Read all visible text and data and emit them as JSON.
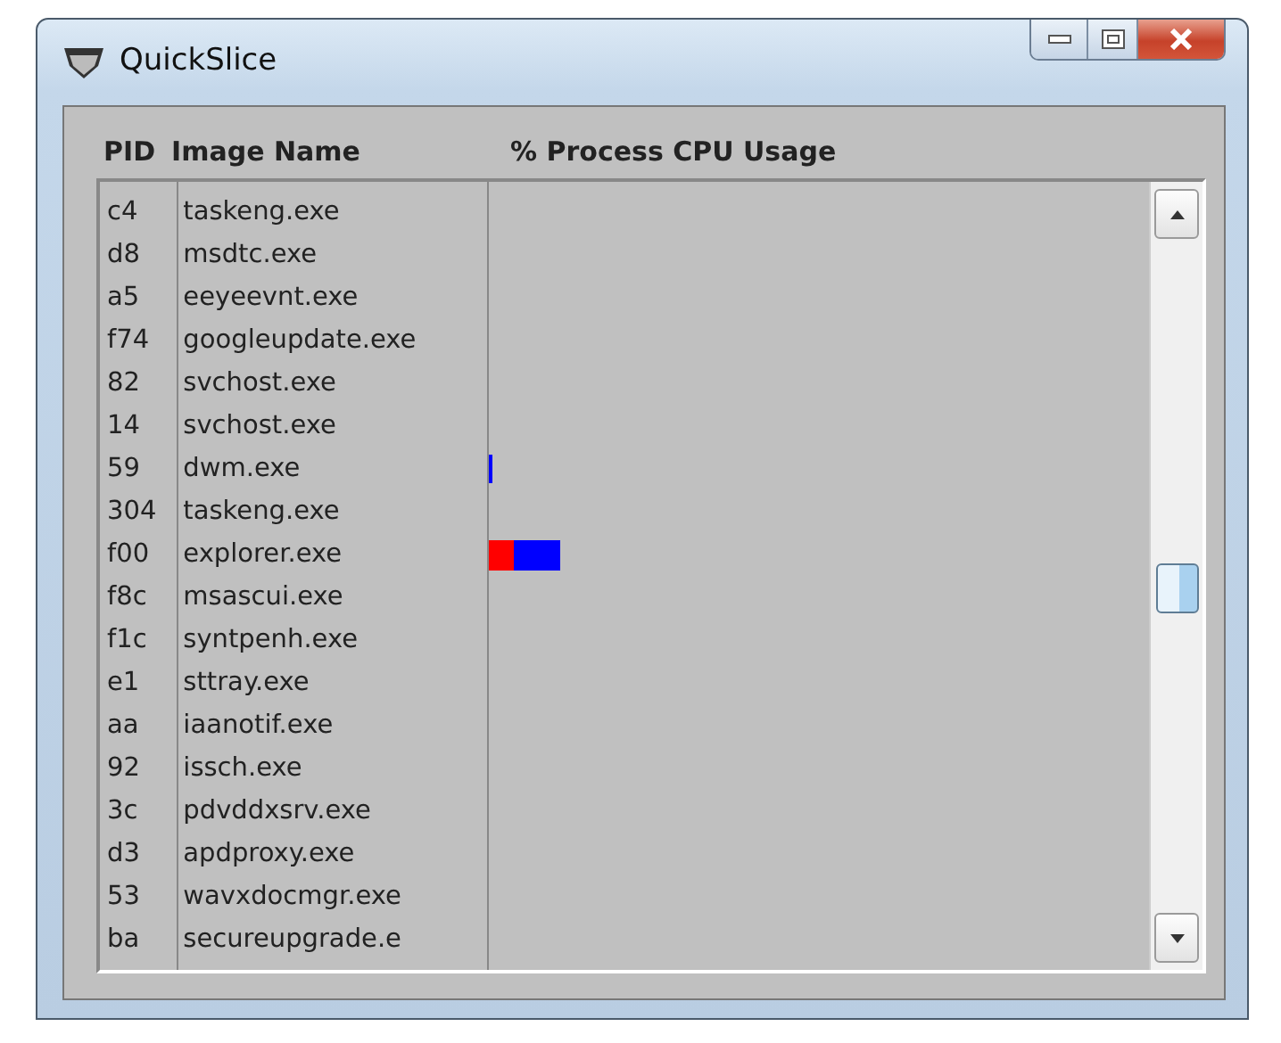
{
  "window": {
    "title": "QuickSlice"
  },
  "columns": [
    {
      "label": "PID"
    },
    {
      "label": "Image Name"
    },
    {
      "label": "% Process CPU Usage"
    }
  ],
  "rows": [
    {
      "pid": "c4",
      "image": "taskeng.exe"
    },
    {
      "pid": "d8",
      "image": "msdtc.exe"
    },
    {
      "pid": "a5",
      "image": "eeyeevnt.exe"
    },
    {
      "pid": "f74",
      "image": "googleupdate.exe"
    },
    {
      "pid": "82",
      "image": "svchost.exe"
    },
    {
      "pid": "14",
      "image": "svchost.exe"
    },
    {
      "pid": "59",
      "image": "dwm.exe",
      "user_cpu": {
        "level": 0.006
      }
    },
    {
      "pid": "304",
      "image": "taskeng.exe"
    },
    {
      "pid": "f00",
      "image": "explorer.exe",
      "kernel_cpu": {
        "level": 0.038
      },
      "user_cpu": {
        "level": 0.07
      }
    },
    {
      "pid": "f8c",
      "image": "msascui.exe"
    },
    {
      "pid": "f1c",
      "image": "syntpenh.exe"
    },
    {
      "pid": "e1",
      "image": "sttray.exe"
    },
    {
      "pid": "aa",
      "image": "iaanotif.exe"
    },
    {
      "pid": "92",
      "image": "issch.exe"
    },
    {
      "pid": "3c",
      "image": "pdvddxsrv.exe"
    },
    {
      "pid": "d3",
      "image": "apdproxy.exe"
    },
    {
      "pid": "53",
      "image": "wavxdocmgr.exe"
    },
    {
      "pid": "ba",
      "image": "secureupgrade.e"
    }
  ]
}
